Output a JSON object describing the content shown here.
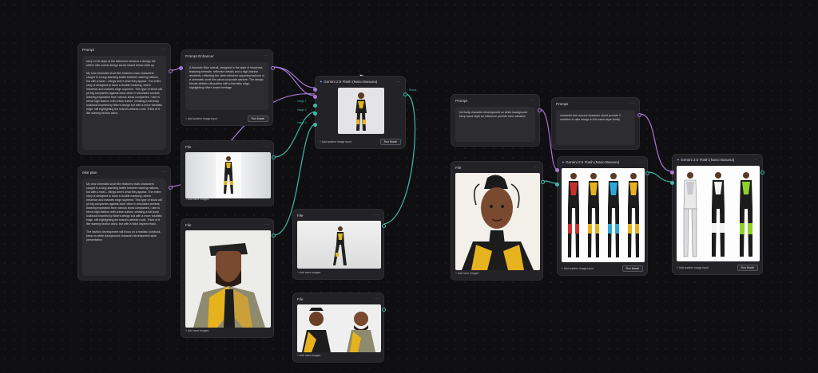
{
  "nodes": {
    "prompt1": {
      "title": "Prompt",
      "text_1": "keep in the style of the reference shownw 4 design the reflect nike overal design sense based below write up",
      "text_2": "My new cinematic short film features main characters caught in a long-standing battle between warring nations, but with a twist – things aren't what they appear. The entire story is designed to have a double meaning, where influence and markets reign supreme. This type of show will pit big companies against each other in simulated combat, drawing inspiration from various show companies. I aim to blend high fashion with urban culture, creating a full-body lookbook inspired by Nike's design but with a more futuristic edge, still highlighting the brand's athletic roots. Think of it like warring faction clans,"
    },
    "enhancer": {
      "title": "Prompt Enhancer",
      "text": "A futuristic Nike overall, designed in the style of shownest, featuring brimade, reflective details and a high-fashion aesthetic, reflecting the clash between opposing factions in a cinematic short film about corporate warfare. The design blends athletic silhouettes with a futuristic edge, highlighting Nike's brand heritage.",
      "footer": "+ Add another image input",
      "button": "Run Model"
    },
    "gemini1": {
      "title": "Gemini 2.5 Flash (Nano Banana)",
      "footer": "+ Add another image input",
      "button": "Run Model",
      "port_in_labels": [
        "Image 1",
        "Image 2",
        "Image 3"
      ],
      "port_out_label": "Result"
    },
    "file1": {
      "title": "File",
      "footer": "+ Add more images"
    },
    "nike_plan": {
      "title": "nike plan",
      "text_1": "My new cinematic short film features main characters caught in a long-standing battle between warring nations, but with a twist – things aren't what they appear. The entire story is designed to have a double meaning, where influence and markets reign supreme. This type of show will pit big companies against each other in simulated combat, drawing inspiration from various show companies. I aim to blend high fashion with urban culture, creating a full-body lookbook inspired by Nike's design but with a more futuristic edge, still highlighting the brand's athletic roots. Think of it like warring faction clans, but with a Nike-inspired twist.",
      "text_2": "The fashion development will focus on a realistic lookbook. keep on white background character development style presentation"
    },
    "file2": {
      "title": "File",
      "footer": "+ Add more images"
    },
    "file3": {
      "title": "File",
      "footer": "+ Add more images"
    },
    "file4": {
      "title": "File",
      "footer": "+ Add more images"
    },
    "prompt2": {
      "title": "Prompt",
      "text": "full body character development on white background keep same style as reference provide color variation"
    },
    "prompt3": {
      "title": "Prompt",
      "text": "character turn around character sheet provide 3 variation to nike design in the same style family"
    },
    "file5": {
      "title": "File",
      "footer": "+ Add more images"
    },
    "gemini2": {
      "title": "Gemini 2.5 Flash (Nano Banana)",
      "footer": "+ Add another image input",
      "button": "Run Model"
    },
    "gemini3": {
      "title": "Gemini 2.5 Flash (Nano Banana)",
      "footer": "+ Add another image input",
      "button": "Run Model"
    }
  },
  "icons": {
    "menu": "more-dots-icon",
    "gemini": "gemini-sparkle-icon"
  },
  "colors": {
    "accent_purple": "#a778d6",
    "accent_teal": "#3fb8a4",
    "node_bg": "#232327",
    "canvas_bg": "#0f0f12"
  }
}
